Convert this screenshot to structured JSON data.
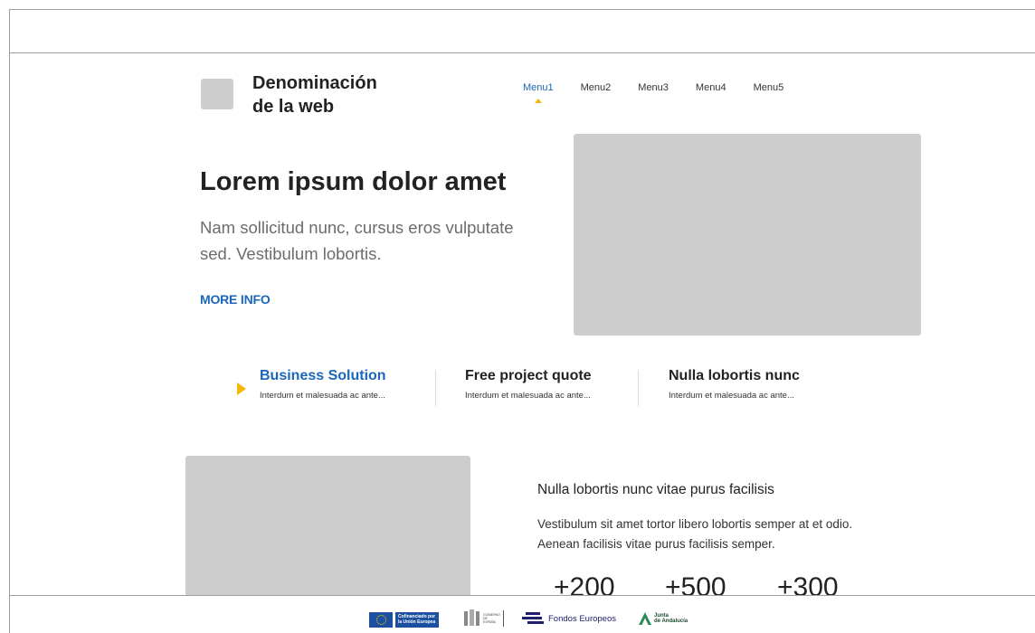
{
  "header": {
    "site_name_line1": "Denominación",
    "site_name_line2": "de la web",
    "nav": [
      {
        "label": "Menu1",
        "active": true
      },
      {
        "label": "Menu2"
      },
      {
        "label": "Menu3"
      },
      {
        "label": "Menu4"
      },
      {
        "label": "Menu5"
      }
    ]
  },
  "hero": {
    "title": "Lorem ipsum dolor amet",
    "subtitle": "Nam sollicitud nunc, cursus eros vulputate sed. Vestibulum lobortis.",
    "cta_label": "MORE INFO"
  },
  "features": [
    {
      "title": "Business Solution",
      "description": "Interdum et malesuada ac ante...",
      "active": true
    },
    {
      "title": "Free project quote",
      "description": "Interdum et malesuada ac ante..."
    },
    {
      "title": "Nulla lobortis nunc",
      "description": "Interdum et malesuada ac ante..."
    }
  ],
  "section": {
    "title": "Nulla lobortis nunc vitae purus facilisis",
    "text": "Vestibulum sit amet tortor libero lobortis semper at et odio. Aenean facilisis vitae purus facilisis semper.",
    "stats": [
      "+200",
      "+500",
      "+300"
    ]
  },
  "footer": {
    "eu_text": "Cofinanciado por la Unión Europea",
    "gob_text": "GOBIERNO DE ESPAÑA",
    "fondos_text": "Fondos Europeos",
    "junta_line1": "Junta",
    "junta_line2": "de Andalucía"
  },
  "colors": {
    "accent": "#1a66b8",
    "highlight": "#f5b800",
    "placeholder": "#cdcdcd"
  }
}
